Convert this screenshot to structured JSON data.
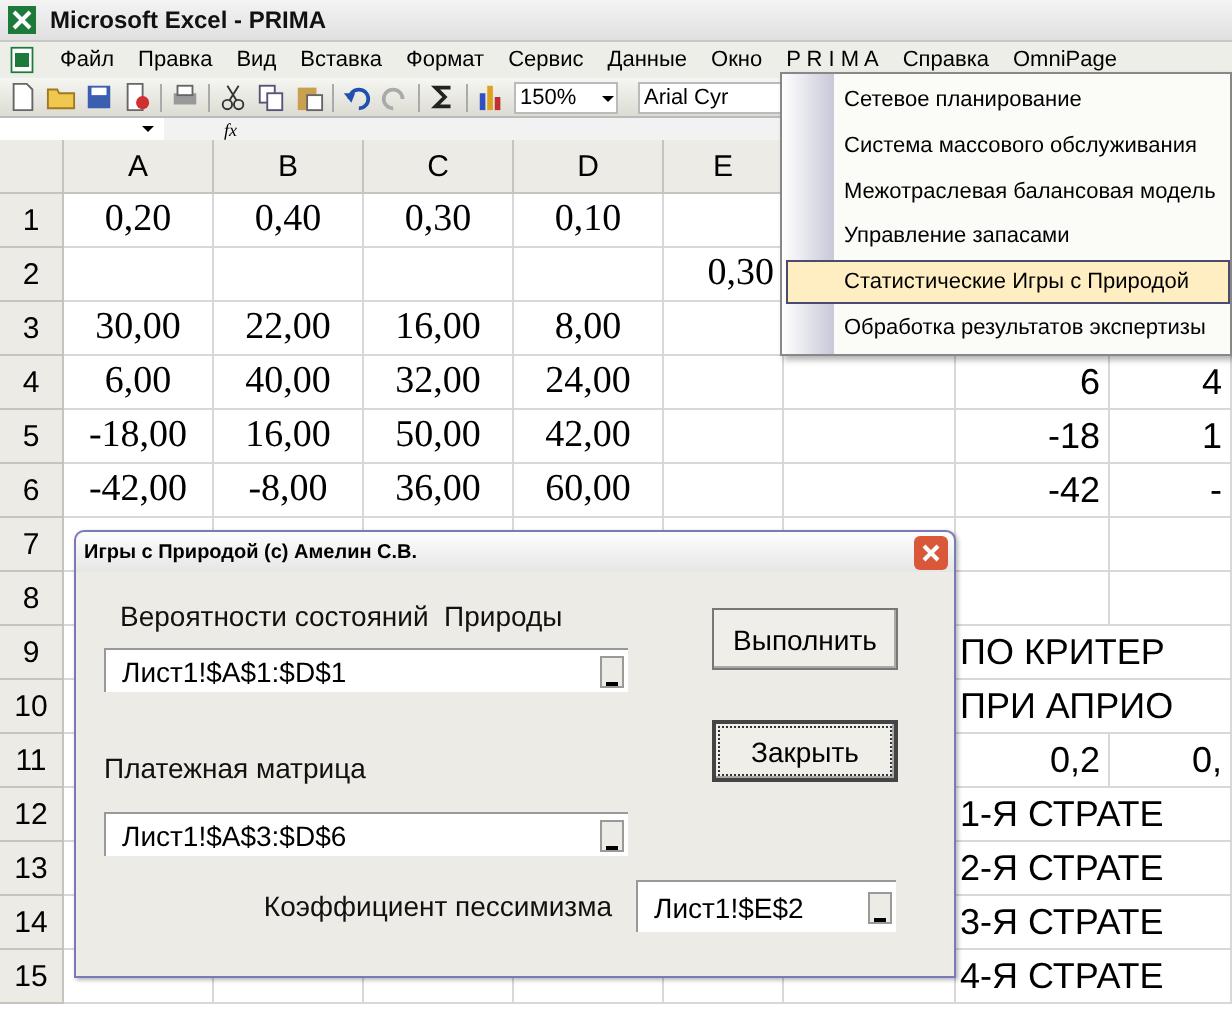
{
  "window": {
    "title": "Microsoft Excel - PRIMA"
  },
  "menu_bar": [
    "Файл",
    "Правка",
    "Вид",
    "Вставка",
    "Формат",
    "Сервис",
    "Данные",
    "Окно",
    "P R I M A",
    "Справка",
    "OmniPage"
  ],
  "toolbar": {
    "zoom": "150%",
    "font": "Arial Cyr"
  },
  "formula_bar": {
    "fx": "fx"
  },
  "dropdown_menu": [
    {
      "label": "Сетевое планирование",
      "selected": false
    },
    {
      "label": "Система массового обслуживания",
      "selected": false
    },
    {
      "label": "Межотраслевая балансовая модель",
      "selected": false
    },
    {
      "label": "Управление запасами",
      "selected": false
    },
    {
      "label": "Статистические Игры с Природой",
      "selected": true
    },
    {
      "label": "Обработка результатов экспертизы",
      "selected": false
    }
  ],
  "sheet": {
    "columns": [
      "A",
      "B",
      "C",
      "D",
      "E"
    ],
    "rows": [
      {
        "number": "1",
        "a": "0,20",
        "b": "0,40",
        "c": "0,30",
        "d": "0,10"
      },
      {
        "number": "2",
        "e": "0,30"
      },
      {
        "number": "3",
        "a": "30,00",
        "b": "22,00",
        "c": "16,00",
        "d": "8,00"
      },
      {
        "number": "4",
        "a": "6,00",
        "b": "40,00",
        "c": "32,00",
        "d": "24,00",
        "g": "6",
        "h": "4"
      },
      {
        "number": "5",
        "a": "-18,00",
        "b": "16,00",
        "c": "50,00",
        "d": "42,00",
        "g": "-18",
        "h": "1"
      },
      {
        "number": "6",
        "a": "-42,00",
        "b": "-8,00",
        "c": "36,00",
        "d": "60,00",
        "g": "-42",
        "h": "-"
      },
      {
        "number": "7"
      },
      {
        "number": "8"
      },
      {
        "number": "9",
        "kind": "label",
        "g": "ПО КРИТЕР"
      },
      {
        "number": "10",
        "kind": "label",
        "g": "ПРИ АПРИО"
      },
      {
        "number": "11",
        "g": "0,2",
        "h": "0,"
      },
      {
        "number": "12",
        "kind": "label",
        "g": "1-Я СТРАТЕ"
      },
      {
        "number": "13",
        "kind": "label",
        "g": "2-Я СТРАТЕ"
      },
      {
        "number": "14",
        "kind": "label",
        "g": "3-Я СТРАТЕ"
      },
      {
        "number": "15",
        "kind": "label",
        "g": "4-Я СТРАТЕ"
      }
    ]
  },
  "dialog": {
    "title": "Игры с Природой (c) Амелин С.В.",
    "fields": [
      {
        "label": "Вероятности состояний  Природы",
        "value": "Лист1!$A$1:$D$1"
      },
      {
        "label": "Платежная матрица",
        "value": "Лист1!$A$3:$D$6"
      },
      {
        "label": "Коэффициент пессимизма",
        "value": "Лист1!$E$2"
      }
    ],
    "buttons": [
      {
        "label": "Выполнить",
        "focused": false
      },
      {
        "label": "Закрыть",
        "focused": true
      }
    ]
  }
}
